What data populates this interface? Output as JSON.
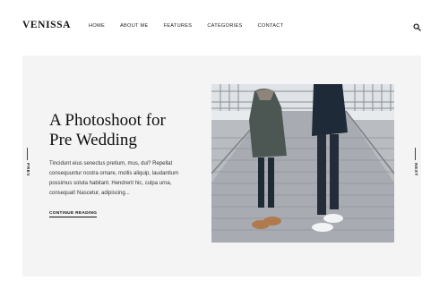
{
  "site": {
    "logo": "VENISSA"
  },
  "nav": {
    "items": [
      {
        "label": "HOME"
      },
      {
        "label": "ABOUT ME"
      },
      {
        "label": "FEATURES"
      },
      {
        "label": "CATEGORIES"
      },
      {
        "label": "CONTACT"
      }
    ],
    "search_icon": "search-icon"
  },
  "slide": {
    "title_line1": "A Photoshoot for",
    "title_line2": "Pre Wedding",
    "excerpt": "Tincidunt eius senectus pretium, mus, dui? Repellat consequuntur nostra ornare, mollis aliquip, laudantium possimus soluta habitant. Hendrerit hic, culpa urna, consequat! Nascetur, adipiscing...",
    "cta": "CONTINUE READING",
    "image": "couple-on-pier-photo"
  },
  "controls": {
    "prev": "PREV",
    "next": "NEXT"
  },
  "colors": {
    "background": "#ffffff",
    "slide_bg": "#f4f4f4",
    "text": "#1c1c1c"
  }
}
